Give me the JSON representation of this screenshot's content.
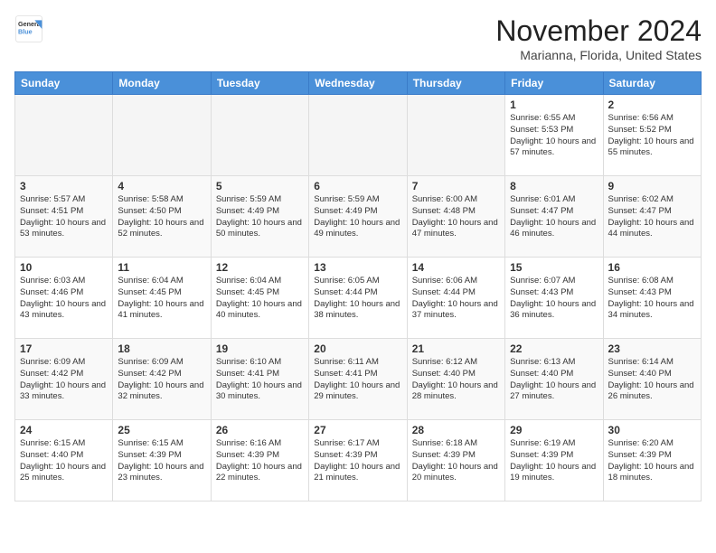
{
  "header": {
    "logo_general": "General",
    "logo_blue": "Blue",
    "month_title": "November 2024",
    "location": "Marianna, Florida, United States"
  },
  "weekdays": [
    "Sunday",
    "Monday",
    "Tuesday",
    "Wednesday",
    "Thursday",
    "Friday",
    "Saturday"
  ],
  "weeks": [
    [
      {
        "day": "",
        "info": ""
      },
      {
        "day": "",
        "info": ""
      },
      {
        "day": "",
        "info": ""
      },
      {
        "day": "",
        "info": ""
      },
      {
        "day": "",
        "info": ""
      },
      {
        "day": "1",
        "info": "Sunrise: 6:55 AM\nSunset: 5:53 PM\nDaylight: 10 hours and 57 minutes."
      },
      {
        "day": "2",
        "info": "Sunrise: 6:56 AM\nSunset: 5:52 PM\nDaylight: 10 hours and 55 minutes."
      }
    ],
    [
      {
        "day": "3",
        "info": "Sunrise: 5:57 AM\nSunset: 4:51 PM\nDaylight: 10 hours and 53 minutes."
      },
      {
        "day": "4",
        "info": "Sunrise: 5:58 AM\nSunset: 4:50 PM\nDaylight: 10 hours and 52 minutes."
      },
      {
        "day": "5",
        "info": "Sunrise: 5:59 AM\nSunset: 4:49 PM\nDaylight: 10 hours and 50 minutes."
      },
      {
        "day": "6",
        "info": "Sunrise: 5:59 AM\nSunset: 4:49 PM\nDaylight: 10 hours and 49 minutes."
      },
      {
        "day": "7",
        "info": "Sunrise: 6:00 AM\nSunset: 4:48 PM\nDaylight: 10 hours and 47 minutes."
      },
      {
        "day": "8",
        "info": "Sunrise: 6:01 AM\nSunset: 4:47 PM\nDaylight: 10 hours and 46 minutes."
      },
      {
        "day": "9",
        "info": "Sunrise: 6:02 AM\nSunset: 4:47 PM\nDaylight: 10 hours and 44 minutes."
      }
    ],
    [
      {
        "day": "10",
        "info": "Sunrise: 6:03 AM\nSunset: 4:46 PM\nDaylight: 10 hours and 43 minutes."
      },
      {
        "day": "11",
        "info": "Sunrise: 6:04 AM\nSunset: 4:45 PM\nDaylight: 10 hours and 41 minutes."
      },
      {
        "day": "12",
        "info": "Sunrise: 6:04 AM\nSunset: 4:45 PM\nDaylight: 10 hours and 40 minutes."
      },
      {
        "day": "13",
        "info": "Sunrise: 6:05 AM\nSunset: 4:44 PM\nDaylight: 10 hours and 38 minutes."
      },
      {
        "day": "14",
        "info": "Sunrise: 6:06 AM\nSunset: 4:44 PM\nDaylight: 10 hours and 37 minutes."
      },
      {
        "day": "15",
        "info": "Sunrise: 6:07 AM\nSunset: 4:43 PM\nDaylight: 10 hours and 36 minutes."
      },
      {
        "day": "16",
        "info": "Sunrise: 6:08 AM\nSunset: 4:43 PM\nDaylight: 10 hours and 34 minutes."
      }
    ],
    [
      {
        "day": "17",
        "info": "Sunrise: 6:09 AM\nSunset: 4:42 PM\nDaylight: 10 hours and 33 minutes."
      },
      {
        "day": "18",
        "info": "Sunrise: 6:09 AM\nSunset: 4:42 PM\nDaylight: 10 hours and 32 minutes."
      },
      {
        "day": "19",
        "info": "Sunrise: 6:10 AM\nSunset: 4:41 PM\nDaylight: 10 hours and 30 minutes."
      },
      {
        "day": "20",
        "info": "Sunrise: 6:11 AM\nSunset: 4:41 PM\nDaylight: 10 hours and 29 minutes."
      },
      {
        "day": "21",
        "info": "Sunrise: 6:12 AM\nSunset: 4:40 PM\nDaylight: 10 hours and 28 minutes."
      },
      {
        "day": "22",
        "info": "Sunrise: 6:13 AM\nSunset: 4:40 PM\nDaylight: 10 hours and 27 minutes."
      },
      {
        "day": "23",
        "info": "Sunrise: 6:14 AM\nSunset: 4:40 PM\nDaylight: 10 hours and 26 minutes."
      }
    ],
    [
      {
        "day": "24",
        "info": "Sunrise: 6:15 AM\nSunset: 4:40 PM\nDaylight: 10 hours and 25 minutes."
      },
      {
        "day": "25",
        "info": "Sunrise: 6:15 AM\nSunset: 4:39 PM\nDaylight: 10 hours and 23 minutes."
      },
      {
        "day": "26",
        "info": "Sunrise: 6:16 AM\nSunset: 4:39 PM\nDaylight: 10 hours and 22 minutes."
      },
      {
        "day": "27",
        "info": "Sunrise: 6:17 AM\nSunset: 4:39 PM\nDaylight: 10 hours and 21 minutes."
      },
      {
        "day": "28",
        "info": "Sunrise: 6:18 AM\nSunset: 4:39 PM\nDaylight: 10 hours and 20 minutes."
      },
      {
        "day": "29",
        "info": "Sunrise: 6:19 AM\nSunset: 4:39 PM\nDaylight: 10 hours and 19 minutes."
      },
      {
        "day": "30",
        "info": "Sunrise: 6:20 AM\nSunset: 4:39 PM\nDaylight: 10 hours and 18 minutes."
      }
    ]
  ]
}
